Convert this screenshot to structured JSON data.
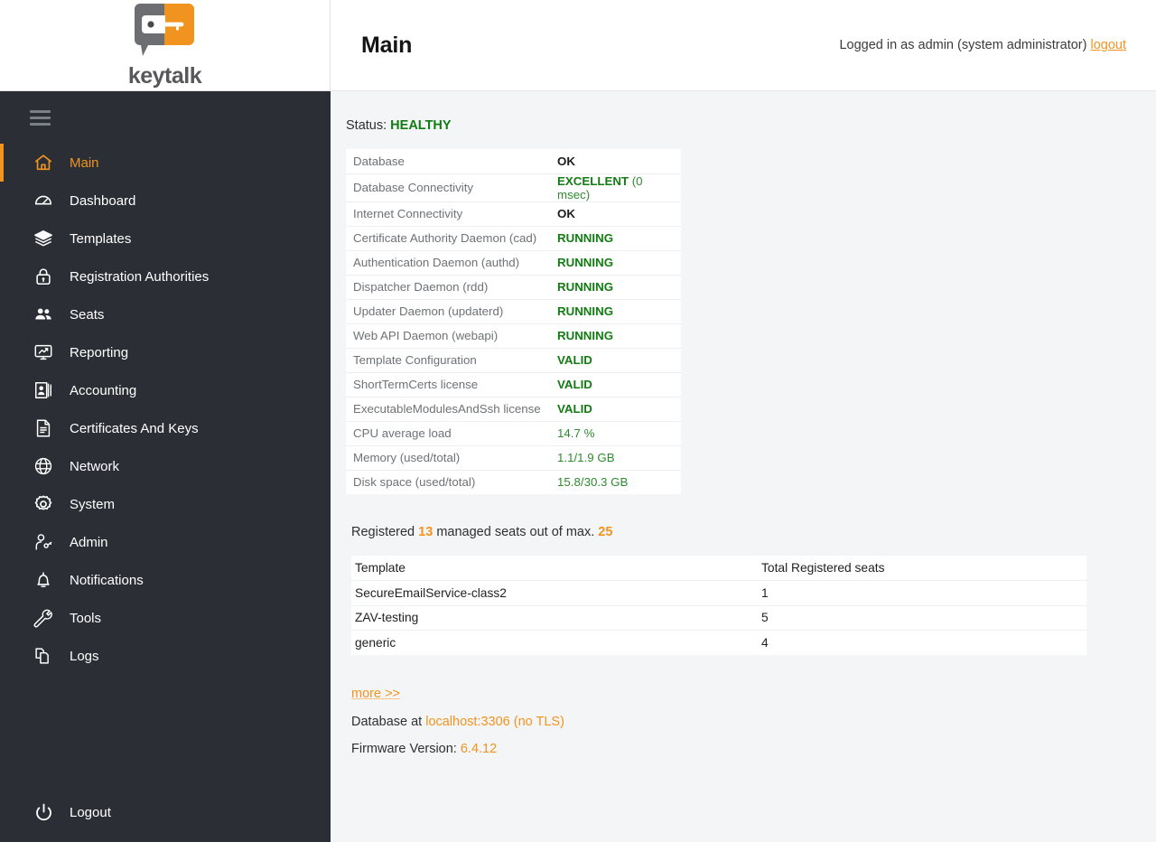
{
  "brand": {
    "name": "keytalk",
    "logo_gray": "#6d6e71",
    "logo_orange": "#f1941f"
  },
  "theme": {
    "accent_orange": "#f1941f",
    "status_green": "#127c12",
    "sidebar_bg": "#2b2e34",
    "page_bg": "#f4f5f7"
  },
  "header": {
    "title": "Main",
    "login_text": "Logged in as admin (system administrator)",
    "logout_label": "logout"
  },
  "sidebar": {
    "menu_toggle": "menu",
    "items": [
      {
        "label": "Main",
        "icon": "home-icon",
        "active": true
      },
      {
        "label": "Dashboard",
        "icon": "gauge-icon",
        "active": false
      },
      {
        "label": "Templates",
        "icon": "layers-icon",
        "active": false
      },
      {
        "label": "Registration Authorities",
        "icon": "lock-icon",
        "active": false
      },
      {
        "label": "Seats",
        "icon": "users-icon",
        "active": false
      },
      {
        "label": "Reporting",
        "icon": "monitor-chart-icon",
        "active": false
      },
      {
        "label": "Accounting",
        "icon": "id-card-icon",
        "active": false
      },
      {
        "label": "Certificates And Keys",
        "icon": "document-icon",
        "active": false
      },
      {
        "label": "Network",
        "icon": "globe-icon",
        "active": false
      },
      {
        "label": "System",
        "icon": "gear-icon",
        "active": false
      },
      {
        "label": "Admin",
        "icon": "user-key-icon",
        "active": false
      },
      {
        "label": "Notifications",
        "icon": "bell-icon",
        "active": false
      },
      {
        "label": "Tools",
        "icon": "wrench-icon",
        "active": false
      },
      {
        "label": "Logs",
        "icon": "copy-files-icon",
        "active": false
      }
    ],
    "logout": {
      "label": "Logout",
      "icon": "power-icon"
    }
  },
  "main": {
    "status_label": "Status:",
    "status_value": "HEALTHY",
    "status_rows": [
      {
        "key": "Database",
        "value": "OK",
        "style": "bold-dark"
      },
      {
        "key": "Database Connectivity",
        "value": "EXCELLENT",
        "suffix": "(0 msec)",
        "style": "bold-green"
      },
      {
        "key": "Internet Connectivity",
        "value": "OK",
        "style": "bold-dark"
      },
      {
        "key": "Certificate Authority Daemon (cad)",
        "value": "RUNNING",
        "style": "bold-green"
      },
      {
        "key": "Authentication Daemon (authd)",
        "value": "RUNNING",
        "style": "bold-green"
      },
      {
        "key": "Dispatcher Daemon (rdd)",
        "value": "RUNNING",
        "style": "bold-green"
      },
      {
        "key": "Updater Daemon (updaterd)",
        "value": "RUNNING",
        "style": "bold-green"
      },
      {
        "key": "Web API Daemon (webapi)",
        "value": "RUNNING",
        "style": "bold-green"
      },
      {
        "key": "Template Configuration",
        "value": "VALID",
        "style": "bold-green"
      },
      {
        "key": "ShortTermCerts license",
        "value": "VALID",
        "style": "bold-green"
      },
      {
        "key": "ExecutableModulesAndSsh license",
        "value": "VALID",
        "style": "bold-green"
      },
      {
        "key": "CPU average load",
        "value": "14.7 %",
        "style": "green"
      },
      {
        "key": "Memory (used/total)",
        "value": "1.1/1.9 GB",
        "style": "green"
      },
      {
        "key": "Disk space (used/total)",
        "value": "15.8/30.3 GB",
        "style": "green"
      }
    ],
    "seats": {
      "prefix": "Registered",
      "registered": "13",
      "middle": "managed seats out of max.",
      "max": "25"
    },
    "templates_table": {
      "columns": [
        "Template",
        "Total Registered seats"
      ],
      "rows": [
        {
          "template": "SecureEmailService-class2",
          "seats": "1"
        },
        {
          "template": "ZAV-testing",
          "seats": "5"
        },
        {
          "template": "generic",
          "seats": "4"
        }
      ]
    },
    "more_link": "more >>",
    "database_label": "Database at",
    "database_value": "localhost:3306 (no TLS)",
    "firmware_label": "Firmware Version:",
    "firmware_value": "6.4.12"
  }
}
